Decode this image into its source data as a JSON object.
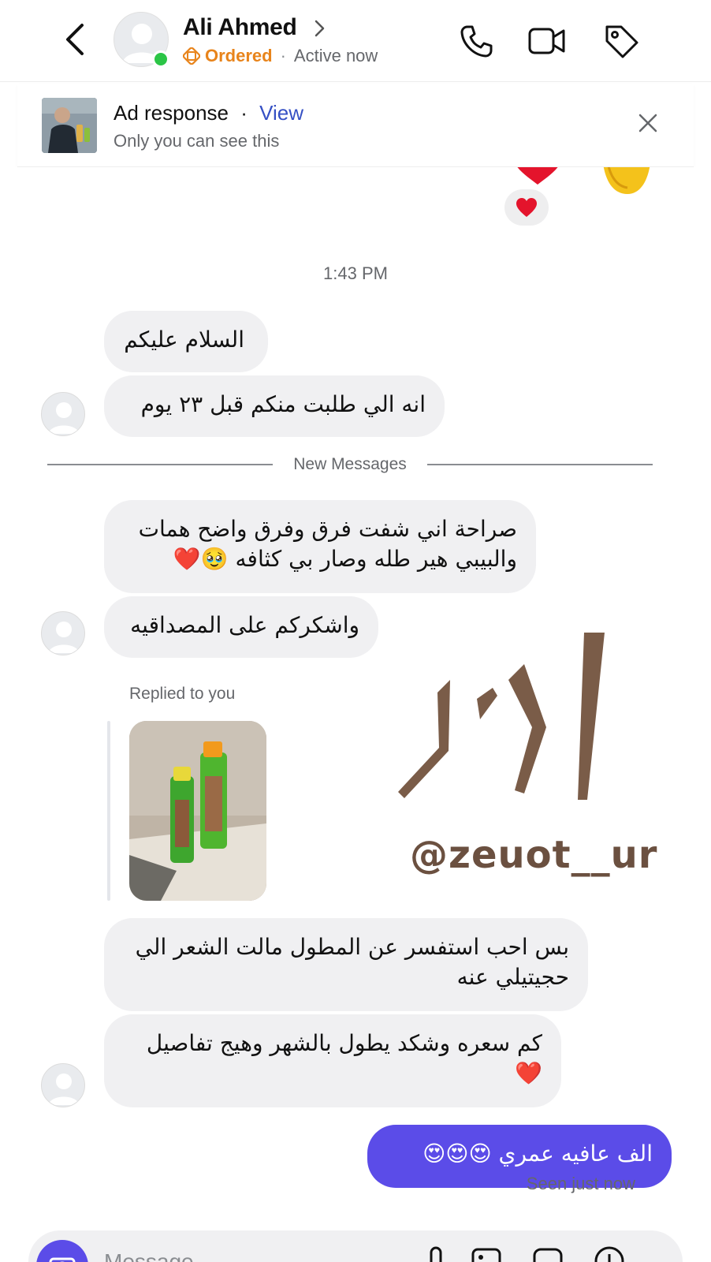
{
  "header": {
    "name": "Ali Ahmed",
    "ordered_label": "Ordered",
    "status": "Active now"
  },
  "ad": {
    "title": "Ad response",
    "view_label": "View",
    "subtitle": "Only you can see this"
  },
  "chat": {
    "timestamp": "1:43 PM",
    "new_messages_label": "New Messages",
    "replied_label": "Replied to you",
    "watermark": "@zeuot__ur",
    "messages": [
      {
        "text": "السلام عليكم"
      },
      {
        "text": "انه الي طلبت منكم قبل  ٢٣ يوم"
      },
      {
        "line1": "صراحة اني شفت فرق وفرق واضح همات",
        "line2": "والبيبي هير طله وصار بي كثافه 🥹❤️"
      },
      {
        "text": "واشكركم على المصداقيه"
      },
      {
        "line1": "بس احب استفسر عن المطول مالت الشعر الي",
        "line2": "حجيتيلي عنه"
      },
      {
        "line1": "كم سعره وشكد يطول بالشهر وهيج تفاصيل",
        "line2": "❤️"
      }
    ],
    "outgoing": {
      "text": "الف عافيه عمري 😍😍😍"
    },
    "seen": "Seen just now"
  },
  "composer": {
    "placeholder": "Message"
  },
  "colors": {
    "accent": "#5b4ce8",
    "ordered": "#e8841b",
    "online": "#2bc546",
    "bubble_in": "#f0f0f2"
  }
}
